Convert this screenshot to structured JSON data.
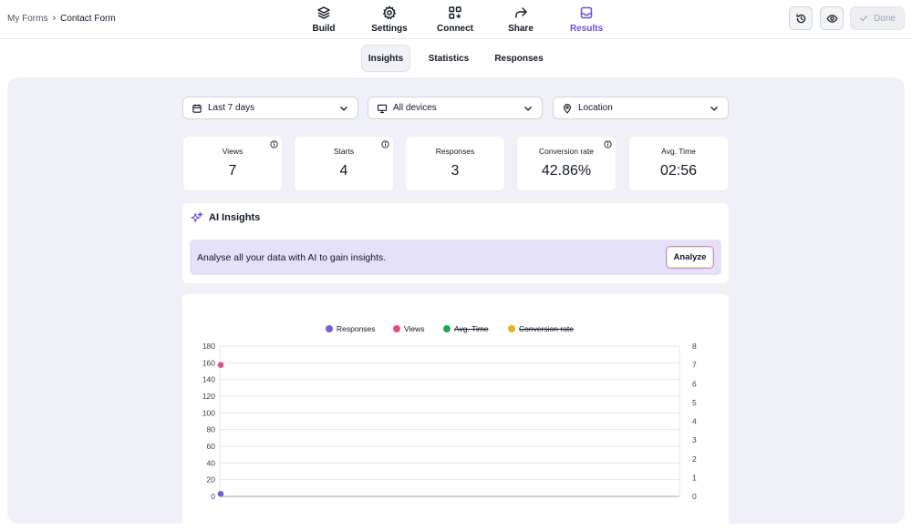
{
  "breadcrumb": {
    "parent": "My Forms",
    "separator": "›",
    "current": "Contact Form"
  },
  "nav": [
    {
      "label": "Build",
      "icon": "layers-icon"
    },
    {
      "label": "Settings",
      "icon": "gear-icon"
    },
    {
      "label": "Connect",
      "icon": "connect-grid-icon"
    },
    {
      "label": "Share",
      "icon": "share-arrow-icon"
    },
    {
      "label": "Results",
      "icon": "inbox-icon",
      "active": true
    }
  ],
  "header_actions": {
    "history_icon": "history-icon",
    "preview_icon": "eye-icon",
    "done_label": "Done"
  },
  "subtabs": [
    {
      "label": "Insights",
      "active": true
    },
    {
      "label": "Statistics"
    },
    {
      "label": "Responses"
    }
  ],
  "filters": {
    "date": "Last 7 days",
    "device": "All devices",
    "location": "Location"
  },
  "stats": [
    {
      "label": "Views",
      "value": "7",
      "info": true
    },
    {
      "label": "Starts",
      "value": "4",
      "info": true
    },
    {
      "label": "Responses",
      "value": "3",
      "info": false
    },
    {
      "label": "Conversion rate",
      "value": "42.86%",
      "info": true
    },
    {
      "label": "Avg. Time",
      "value": "02:56",
      "info": false
    }
  ],
  "ai": {
    "title": "AI Insights",
    "prompt": "Analyse all your data with AI to gain insights.",
    "button": "Analyze"
  },
  "colors": {
    "accent": "#6d4fd8",
    "responses": "#6f63d9",
    "views": "#e0507a",
    "avg_time": "#22a55a",
    "conversion": "#e9b31a"
  },
  "chart_data": {
    "type": "scatter",
    "title": "",
    "legend": [
      {
        "name": "Responses",
        "color": "#6f63d9",
        "hidden": false
      },
      {
        "name": "Views",
        "color": "#e0507a",
        "hidden": false
      },
      {
        "name": "Avg. Time",
        "color": "#22a55a",
        "hidden": true
      },
      {
        "name": "Conversion rate",
        "color": "#e9b31a",
        "hidden": true
      }
    ],
    "y_left_ticks": [
      "0",
      "20",
      "40",
      "60",
      "80",
      "100",
      "120",
      "140",
      "160",
      "180"
    ],
    "y_right_ticks": [
      "0",
      "1",
      "2",
      "3",
      "4",
      "5",
      "6",
      "7",
      "8"
    ],
    "y_left_range": [
      0,
      180
    ],
    "y_right_range": [
      0,
      8
    ],
    "grid": true,
    "series": [
      {
        "name": "Responses",
        "axis": "left",
        "values": [
          3
        ]
      },
      {
        "name": "Views",
        "axis": "right",
        "values": [
          7
        ]
      }
    ]
  }
}
